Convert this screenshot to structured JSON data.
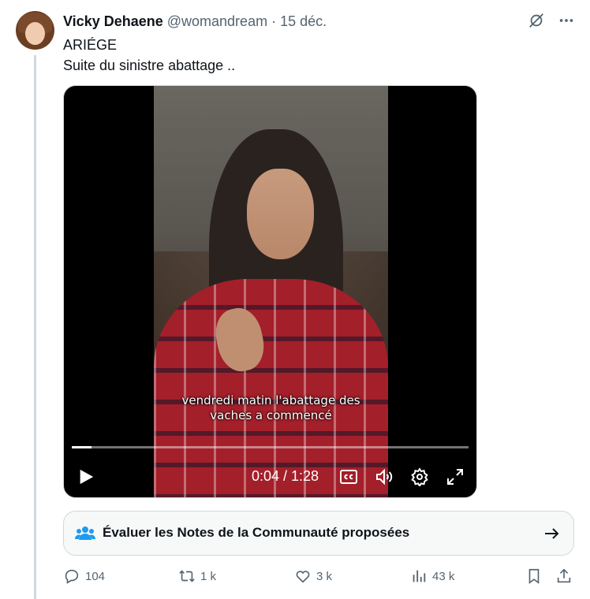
{
  "author": {
    "name": "Vicky Dehaene",
    "handle": "@womandream",
    "separator": "·",
    "date": "15 déc."
  },
  "tweet": {
    "line1": "ARIÉGE",
    "line2": "Suite du sinistre abattage .."
  },
  "video": {
    "caption_line1": "vendredi matin l'abattage des",
    "caption_line2": "vaches a commencé",
    "time": "0:04 / 1:28",
    "progress": 0.05
  },
  "community_notes": {
    "label": "Évaluer les Notes de la Communauté proposées"
  },
  "actions": {
    "replies": "104",
    "reposts": "1 k",
    "likes": "3 k",
    "views": "43 k"
  },
  "colors": {
    "text": "#0f1419",
    "secondary": "#536471",
    "accent": "#1d9bf0",
    "border": "#cfd9de"
  },
  "icons": [
    "grok-icon",
    "more-icon",
    "play-icon",
    "cc-icon",
    "volume-icon",
    "settings-icon",
    "fullscreen-icon",
    "people-icon",
    "arrow-right-icon",
    "reply-icon",
    "repost-icon",
    "like-icon",
    "views-icon",
    "bookmark-icon",
    "share-icon"
  ]
}
